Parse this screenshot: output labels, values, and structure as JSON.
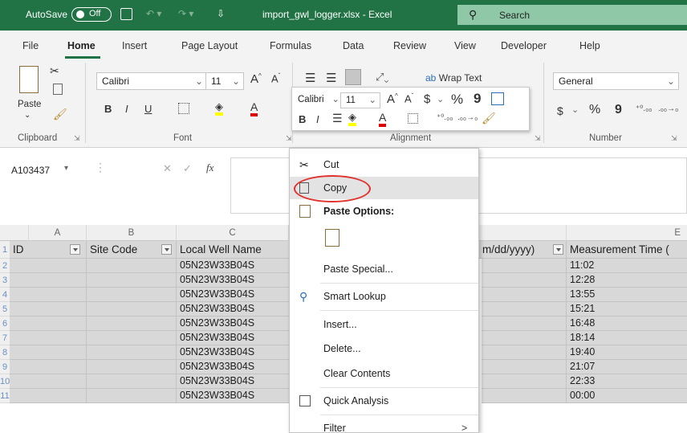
{
  "title_bar": {
    "autosave_label": "AutoSave",
    "autosave_state": "Off",
    "filename": "import_gwl_logger.xlsx  -  Excel",
    "search_placeholder": "Search",
    "bg_color": "#217346"
  },
  "ribbon_tabs": [
    "File",
    "Home",
    "Insert",
    "Page Layout",
    "Formulas",
    "Data",
    "Review",
    "View",
    "Developer",
    "Help"
  ],
  "ribbon": {
    "paste_label": "Paste",
    "font_name": "Calibri",
    "font_size": "11",
    "wrap_text": "Wrap Text",
    "number_format": "General",
    "groups": {
      "clipboard": "Clipboard",
      "font": "Font",
      "alignment": "Alignment",
      "number": "Number"
    },
    "bold": "B",
    "italic": "I",
    "underline": "U",
    "currency": "$",
    "percent": "%",
    "comma": "9"
  },
  "mini_toolbar": {
    "font_name": "Calibri",
    "font_size": "11",
    "currency": "$",
    "percent": "%",
    "comma": "9",
    "bold": "B",
    "italic": "I"
  },
  "formula_bar": {
    "name_box": "A103437",
    "fx": "fx"
  },
  "columns": [
    "A",
    "B",
    "C",
    "E"
  ],
  "header_row": {
    "a": "ID",
    "b": "Site Code",
    "c": "Local Well Name",
    "d": "m/dd/yyyy)",
    "e": "Measurement Time ("
  },
  "rows": [
    {
      "num": "2",
      "c": "05N23W33B04S",
      "e": "11:02"
    },
    {
      "num": "3",
      "c": "05N23W33B04S",
      "e": "12:28"
    },
    {
      "num": "4",
      "c": "05N23W33B04S",
      "e": "13:55"
    },
    {
      "num": "5",
      "c": "05N23W33B04S",
      "e": "15:21"
    },
    {
      "num": "6",
      "c": "05N23W33B04S",
      "e": "16:48"
    },
    {
      "num": "7",
      "c": "05N23W33B04S",
      "e": "18:14"
    },
    {
      "num": "8",
      "c": "05N23W33B04S",
      "e": "19:40"
    },
    {
      "num": "9",
      "c": "05N23W33B04S",
      "e": "21:07"
    },
    {
      "num": "10",
      "c": "05N23W33B04S",
      "e": "22:33"
    },
    {
      "num": "11",
      "c": "05N23W33B04S",
      "e": "00:00"
    }
  ],
  "header_row_num": "1",
  "context_menu": {
    "cut": "Cut",
    "copy": "Copy",
    "paste_options": "Paste Options:",
    "paste_special": "Paste Special...",
    "smart_lookup": "Smart Lookup",
    "insert": "Insert...",
    "delete": "Delete...",
    "clear_contents": "Clear Contents",
    "quick_analysis": "Quick Analysis",
    "filter": "Filter",
    "submenu_arrow": ">"
  },
  "highlight_color": "#e0332e"
}
